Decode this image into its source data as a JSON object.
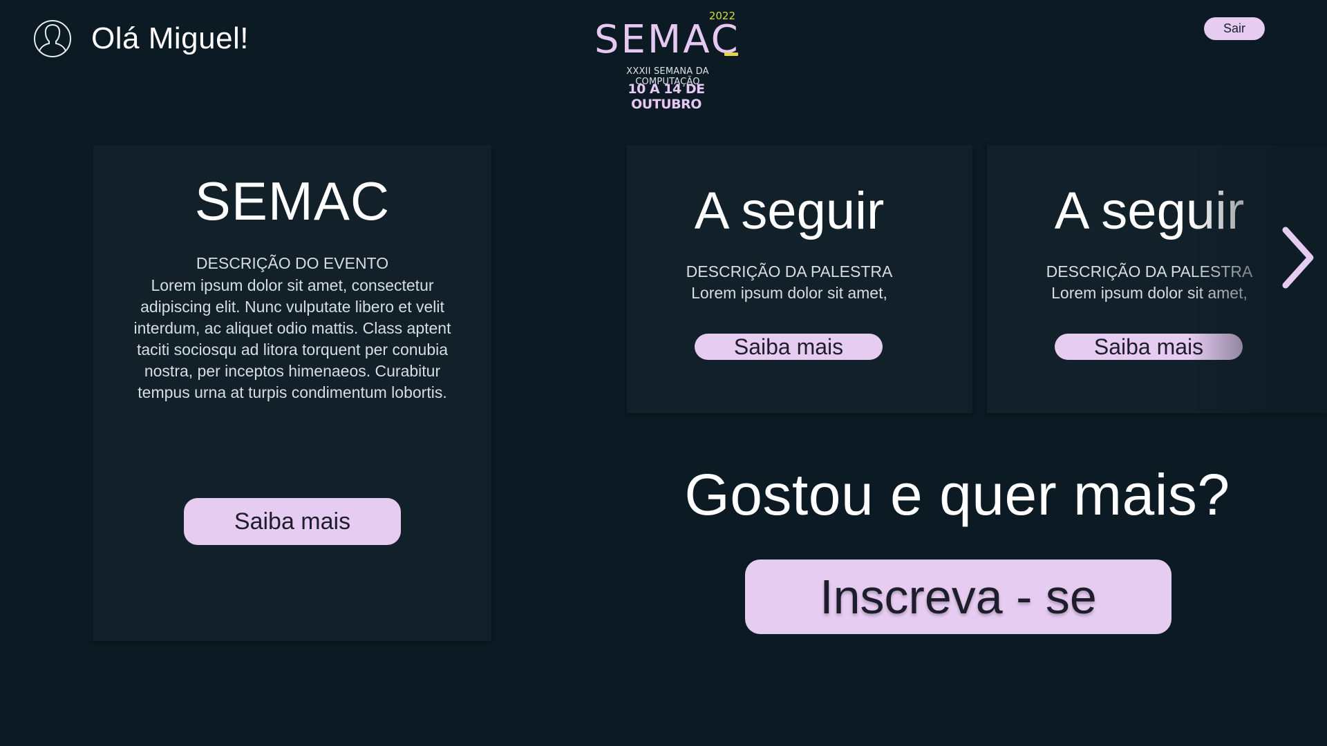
{
  "header": {
    "greeting": "Olá Miguel!",
    "logout_label": "Sair",
    "logo": {
      "year": "2022",
      "word": "SEMAC",
      "subtitle": "XXXII SEMANA DA COMPUTAÇÃO",
      "dates": "10 A 14 DE OUTUBRO"
    }
  },
  "event_card": {
    "title": "SEMAC",
    "description_title": "DESCRIÇÃO DO EVENTO",
    "description": "Lorem ipsum dolor sit amet, consectetur adipiscing elit. Nunc vulputate libero et velit interdum, ac aliquet odio mattis. Class aptent taciti sociosqu ad litora torquent per conubia nostra, per inceptos himenaeos. Curabitur tempus urna at turpis condimentum lobortis.",
    "button_label": "Saiba mais"
  },
  "talk_cards": [
    {
      "title": "A seguir",
      "description_title": "DESCRIÇÃO DA PALESTRA",
      "description": "Lorem ipsum dolor sit amet,",
      "button_label": "Saiba mais"
    },
    {
      "title": "A seguir",
      "description_title": "DESCRIÇÃO DA PALESTRA",
      "description": "Lorem ipsum dolor sit amet,",
      "button_label": "Saiba mais"
    }
  ],
  "carousel": {
    "next_icon": "chevron-right-icon"
  },
  "cta": {
    "title": "Gostou e quer mais?",
    "button_label": "Inscreva - se"
  },
  "colors": {
    "background": "#0c1a24",
    "card": "#112029",
    "accent": "#e6ccf1",
    "logo_yellow": "#d7dd3a"
  }
}
